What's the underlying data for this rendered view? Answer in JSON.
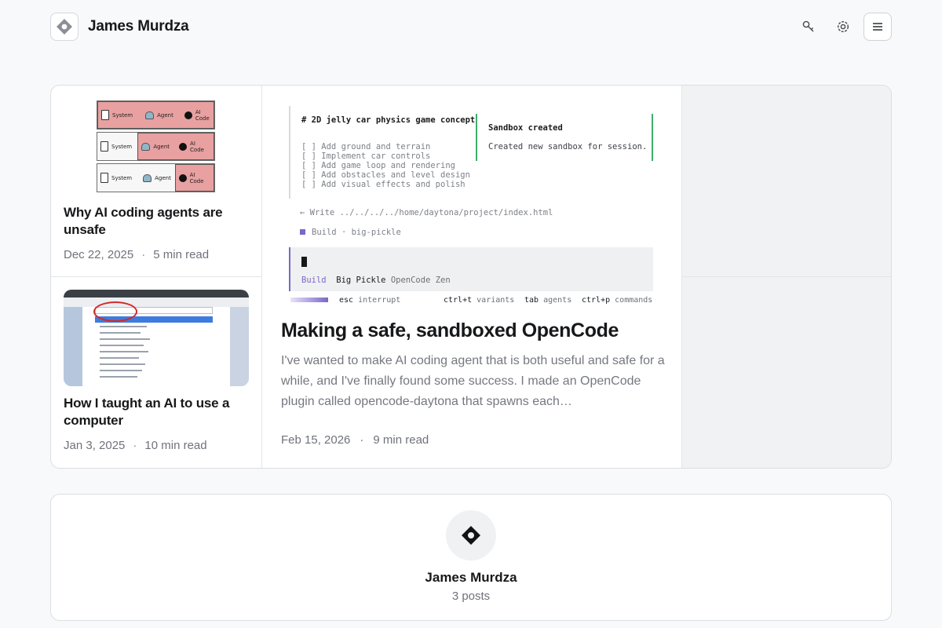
{
  "site": {
    "name": "James Murdza"
  },
  "header": {
    "icons": [
      "key-icon",
      "gear-icon",
      "menu-icon"
    ]
  },
  "posts": {
    "side_top": {
      "title": "Why AI coding agents are unsafe",
      "date": "Dec 22, 2025",
      "separator": "·",
      "read_time": "5 min read",
      "diagram": {
        "rows": [
          {
            "system": "System",
            "agent": "Agent",
            "ai": "AI Code"
          },
          {
            "system": "System",
            "agent": "Agent",
            "ai": "AI Code"
          },
          {
            "system": "System",
            "agent": "Agent",
            "ai": "AI Code"
          }
        ]
      }
    },
    "side_bottom": {
      "title": "How I taught an AI to use a computer",
      "date": "Jan 3, 2025",
      "separator": "·",
      "read_time": "10 min read"
    },
    "featured": {
      "title": "Making a safe, sandboxed OpenCode",
      "excerpt": "I've wanted to make AI coding agent that is both useful and safe for a while, and I've finally found some success. I made an OpenCode plugin called opencode-daytona that spawns each…",
      "date": "Feb 15, 2026",
      "separator": "·",
      "read_time": "9 min read",
      "terminal": {
        "heading": "# 2D jelly car physics game concept",
        "todos": [
          "[ ] Add ground and terrain",
          "[ ] Implement car controls",
          "[ ] Add game loop and rendering",
          "[ ] Add obstacles and level design",
          "[ ] Add visual effects and polish"
        ],
        "notice_title": "Sandbox created",
        "notice_body": "Created new sandbox for session.",
        "write_line": "← Write ../../../../home/daytona/project/index.html",
        "build_label": "Build",
        "build_model": "· big-pickle",
        "input_mode": "Build",
        "input_model": "Big Pickle",
        "input_provider": "OpenCode Zen",
        "status": {
          "esc_key": "esc",
          "esc_label": "interrupt",
          "variants_key": "ctrl+t",
          "variants_label": "variants",
          "agents_key": "tab",
          "agents_label": "agents",
          "commands_key": "ctrl+p",
          "commands_label": "commands"
        }
      }
    }
  },
  "author": {
    "name": "James Murdza",
    "post_count": "3 posts"
  }
}
